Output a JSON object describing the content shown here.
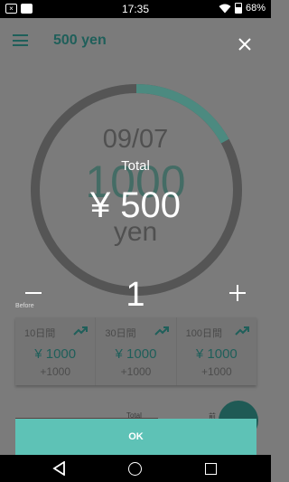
{
  "status_bar": {
    "time": "17:35",
    "battery": "68%",
    "left_icons": [
      "notification-x-icon",
      "image-icon"
    ],
    "right_icons": [
      "wifi-icon",
      "battery-icon"
    ]
  },
  "header": {
    "title": "500 yen",
    "menu_icon": "menu-icon",
    "close_icon": "close-icon"
  },
  "ring": {
    "date": "09/07",
    "amount": "1000",
    "unit": "yen",
    "progress": 0.17,
    "track_color": "#555555",
    "fill_color": "#4c8a80"
  },
  "overlay": {
    "total_label": "Total",
    "total_value": "¥ 500"
  },
  "stepper": {
    "value": "1",
    "before_label": "Before"
  },
  "cards": [
    {
      "label": "10日間",
      "amount": "¥ 1000",
      "delta": "+1000"
    },
    {
      "label": "30日間",
      "amount": "¥ 1000",
      "delta": "+1000"
    },
    {
      "label": "100日間",
      "amount": "¥ 1000",
      "delta": "+1000"
    }
  ],
  "bottom": {
    "total_label": "Total",
    "prev_label": "前"
  },
  "ok_button": {
    "label": "OK"
  },
  "colors": {
    "accent": "#5ec2b6",
    "dark_teal": "#1f5f5a"
  }
}
